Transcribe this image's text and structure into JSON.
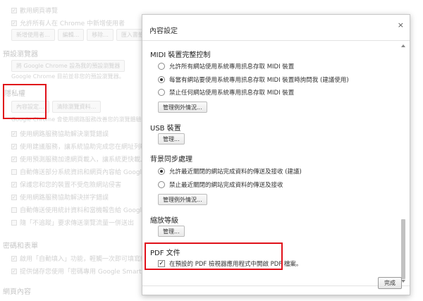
{
  "background": {
    "row1": "歡用網頁導覽",
    "row2": "允許所有人在 Chrome 中新增使用者",
    "btn_add_user": "新增使用者...",
    "btn_edit": "編輯...",
    "btn_remove": "移除...",
    "btn_import": "匯入書籤和設定...",
    "default_browser_title": "預設瀏覽器",
    "btn_default_browser": "將 Google Chrome 設為我的預設瀏覽器",
    "default_browser_desc": "Google Chrome 目前並非您的預設瀏覽器。",
    "privacy_title": "隱私權",
    "btn_content_settings": "內容設定...",
    "btn_clear_data": "清除瀏覽資料...",
    "privacy_desc": "Google Chrome 會使用網路服務改善您的瀏覽體驗，您可以選擇是否停用這些服務。",
    "privacy_items": [
      "使用網路服務協助解決瀏覽錯誤",
      "使用建議服務，讓系統協助完成您在網址列輸入的搜尋查詢和網址",
      "使用預測服務加速網頁載入，讓系統更快載入網頁",
      "自動傳送部分系統資訊和網頁內容給 Google，協助偵測危險應用程式和網站",
      "保護您和您的裝置不受危險網站侵害",
      "使用網路服務協助解決拼字錯誤",
      "自動傳送使用統計資料和當機報告給 Google",
      "隨「不追蹤」要求傳送瀏覽流量一併送出"
    ],
    "passwords_title": "密碼和表單",
    "passwords_items": [
      "啟用「自動填入」功能，輕觸一次即可填寫網路表單。",
      "提供儲存您使用「密碼專用 Google Smart Lock」儲存網頁密碼"
    ],
    "web_content_title": "網頁內容"
  },
  "dialog": {
    "title": "內容設定",
    "close_glyph": "×",
    "midi": {
      "heading": "MIDI 裝置完整控制",
      "options": [
        "允許所有網站使用系統專用訊息存取 MIDI 裝置",
        "每當有網站要使用系統專用訊息存取 MIDI 裝置時詢問我 (建議使用)",
        "禁止任何網站使用系統專用訊息存取 MIDI 裝置"
      ],
      "selected": 1,
      "manage_label": "管理例外情況..."
    },
    "usb": {
      "heading": "USB 裝置",
      "manage_label": "管理..."
    },
    "background_sync": {
      "heading": "背景同步處理",
      "options": [
        "允許最近關閉的網站完成資料的傳送及接收 (建議)",
        "禁止最近關閉的網站完成資料的傳送及接收"
      ],
      "selected": 0,
      "manage_label": "管理例外情況..."
    },
    "zoom": {
      "heading": "縮放等級",
      "manage_label": "管理..."
    },
    "pdf": {
      "heading": "PDF 文件",
      "checkbox_label": "在預設的 PDF 檢視器應用程式中開啟 PDF 檔案。",
      "checked": true
    },
    "done_label": "完成"
  },
  "colors": {
    "highlight": "#e0101a"
  }
}
